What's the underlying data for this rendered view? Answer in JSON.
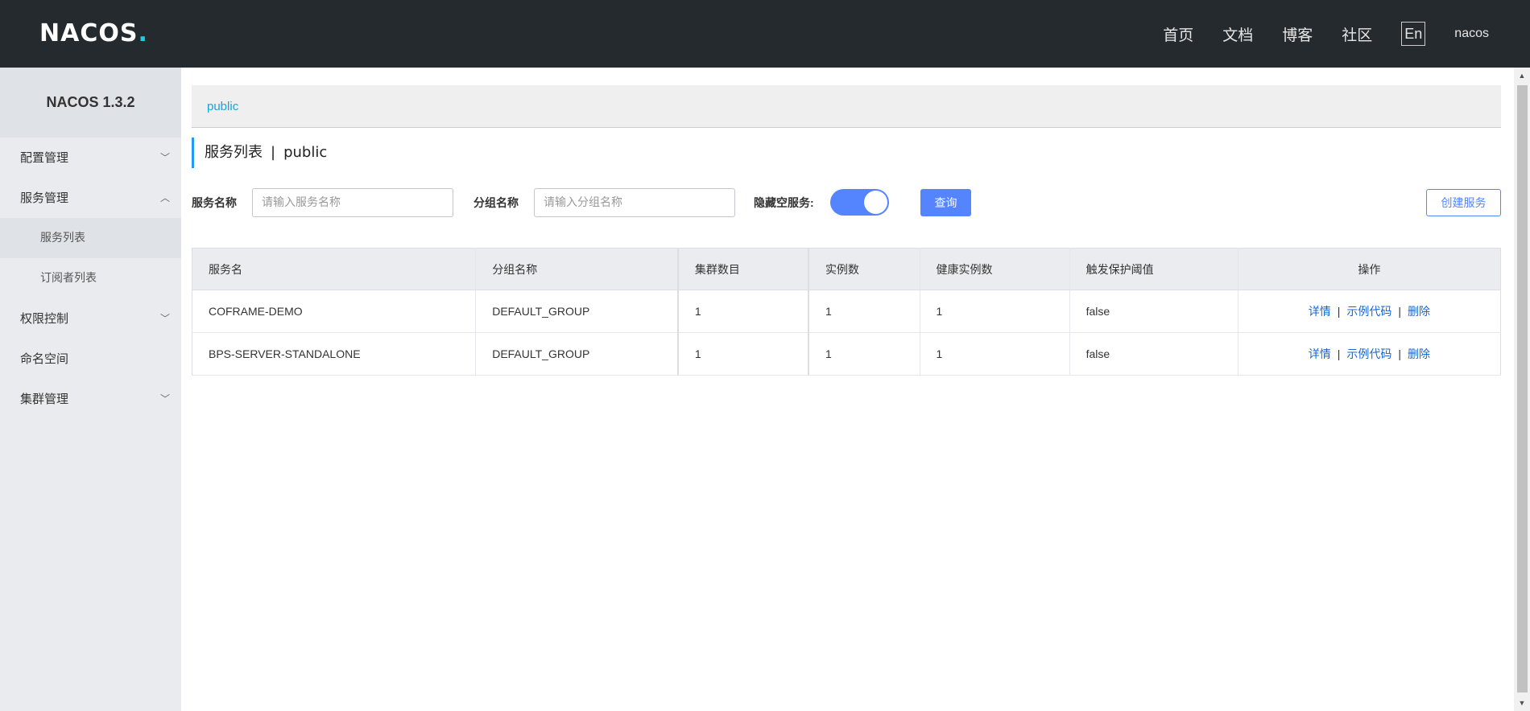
{
  "header": {
    "logo_text": "NACOS",
    "logo_dot": ".",
    "nav": [
      "首页",
      "文档",
      "博客",
      "社区"
    ],
    "lang": "En",
    "user": "nacos"
  },
  "sidebar": {
    "version": "NACOS 1.3.2",
    "items": [
      {
        "label": "配置管理",
        "chevron": "chevron-down-icon"
      },
      {
        "label": "服务管理",
        "chevron": "chevron-up-icon"
      },
      {
        "label": "服务列表"
      },
      {
        "label": "订阅者列表"
      },
      {
        "label": "权限控制",
        "chevron": "chevron-down-icon"
      },
      {
        "label": "命名空间"
      },
      {
        "label": "集群管理",
        "chevron": "chevron-down-icon"
      }
    ]
  },
  "main": {
    "namespace": "public",
    "title": "服务列表",
    "title_sep": "|",
    "title_ns": "public",
    "filters": {
      "service_name_label": "服务名称",
      "service_name_placeholder": "请输入服务名称",
      "group_name_label": "分组名称",
      "group_name_placeholder": "请输入分组名称",
      "hide_empty_label": "隐藏空服务:",
      "hide_empty_on": true,
      "query_button": "查询",
      "create_button": "创建服务"
    },
    "table": {
      "headers": [
        "服务名",
        "分组名称",
        "集群数目",
        "实例数",
        "健康实例数",
        "触发保护阈值",
        "操作"
      ],
      "rows": [
        {
          "name": "COFRAME-DEMO",
          "group": "DEFAULT_GROUP",
          "clusters": "1",
          "instances": "1",
          "healthy": "1",
          "threshold": "false"
        },
        {
          "name": "BPS-SERVER-STANDALONE",
          "group": "DEFAULT_GROUP",
          "clusters": "1",
          "instances": "1",
          "healthy": "1",
          "threshold": "false"
        }
      ],
      "ops": {
        "detail": "详情",
        "sample": "示例代码",
        "delete": "删除",
        "sep": "|"
      }
    }
  },
  "colors": {
    "header_bg": "#252a2f",
    "accent": "#5584ff",
    "link": "#1a66d1",
    "namespace": "#1ba3d8"
  }
}
